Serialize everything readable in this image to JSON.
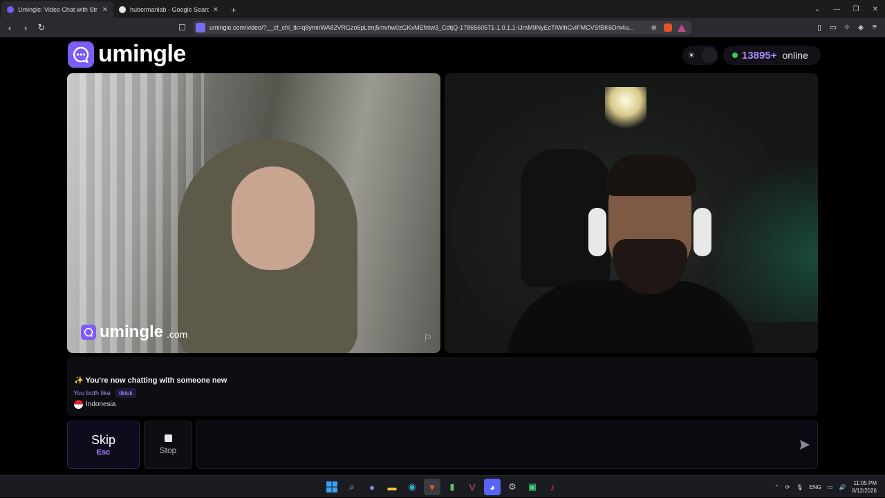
{
  "browser": {
    "tabs": [
      {
        "title": "Umingle: Video Chat with Str",
        "active": true,
        "favicon_color": "#7c5cf5"
      },
      {
        "title": "hubermanlab - Google Search",
        "active": false,
        "favicon_color": "#e8e8e8"
      }
    ],
    "new_tab_label": "+",
    "url": "umingle.com/video/?__cf_chl_tk=q8ymnWA82VRGzo6pLtmj5mvhw0zGKxMEfntw3_CdtjQ-1786560571-1.0.1.1-IJmM9NyEcTIWihCvIFMCVSfBK6Dm4u..."
  },
  "header": {
    "logo_text": "umingle",
    "online_count": "13895+",
    "online_label": "online",
    "theme_icon": "sun-icon"
  },
  "video_left": {
    "watermark_text": "umingle",
    "watermark_suffix": ".com",
    "report_icon": "flag-icon"
  },
  "chat": {
    "system_emoji": "✨",
    "system_message": "You're now chatting with someone new",
    "shared_interest_label": "You both like",
    "shared_interest_tag": "tiktok",
    "country": "Indonesia"
  },
  "controls": {
    "skip_label": "Skip",
    "skip_key": "Esc",
    "stop_label": "Stop",
    "message_placeholder": "",
    "send_icon": "send-icon"
  },
  "taskbar": {
    "language": "ENG",
    "time": "11:05 PM",
    "date": "8/12/2026"
  },
  "colors": {
    "accent": "#7c5cf5",
    "accent_text": "#a988ff",
    "online_dot": "#31c75f"
  }
}
